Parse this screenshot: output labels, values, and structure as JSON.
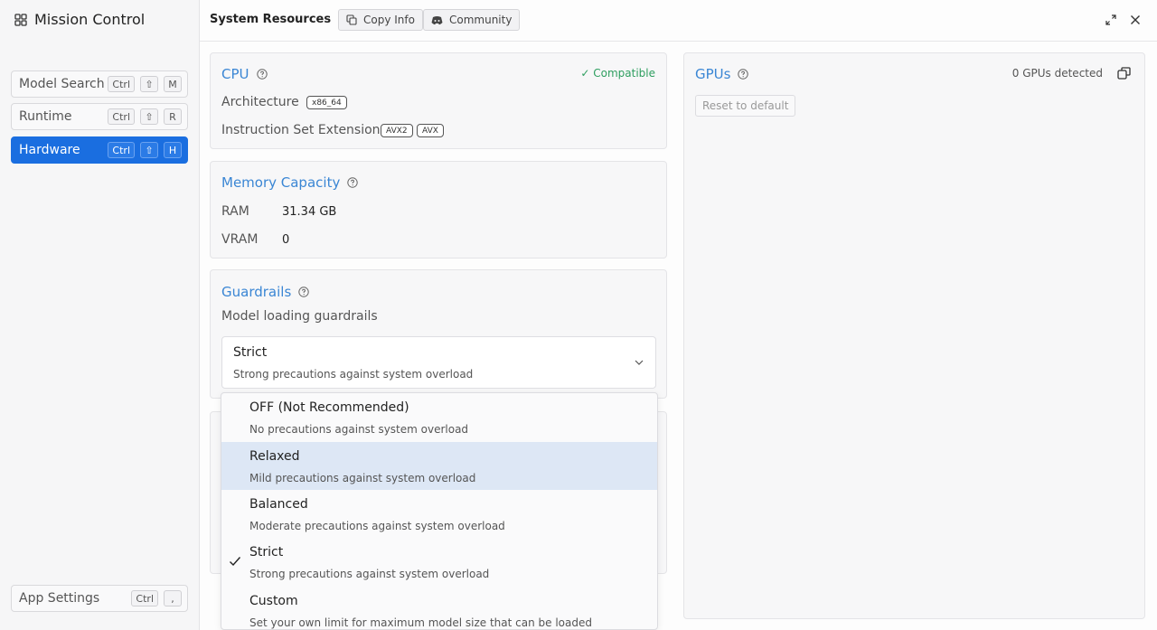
{
  "app": {
    "title": "Mission Control"
  },
  "sidebar": {
    "items": [
      {
        "label": "Model Search",
        "keys": [
          "Ctrl",
          "⇧",
          "M"
        ]
      },
      {
        "label": "Runtime",
        "keys": [
          "Ctrl",
          "⇧",
          "R"
        ]
      },
      {
        "label": "Hardware",
        "keys": [
          "Ctrl",
          "⇧",
          "H"
        ],
        "active": true
      }
    ],
    "settings": {
      "label": "App Settings",
      "keys": [
        "Ctrl",
        ","
      ]
    }
  },
  "topbar": {
    "title": "System Resources",
    "copy_label": "Copy Info",
    "community_label": "Community"
  },
  "cpu": {
    "title": "CPU",
    "status": "✓ Compatible",
    "architecture_label": "Architecture",
    "architecture_value": "x86_64",
    "extensions_label": "Instruction Set Extensions",
    "extensions": [
      "AVX2",
      "AVX"
    ]
  },
  "memory": {
    "title": "Memory Capacity",
    "ram_label": "RAM",
    "ram_value": "31.34 GB",
    "vram_label": "VRAM",
    "vram_value": "0"
  },
  "guardrails": {
    "title": "Guardrails",
    "subtitle": "Model loading guardrails",
    "selected_label": "Strict",
    "selected_desc": "Strong precautions against system overload",
    "options": [
      {
        "label": "OFF (Not Recommended)",
        "desc": "No precautions against system overload"
      },
      {
        "label": "Relaxed",
        "desc": "Mild precautions against system overload",
        "highlighted": true
      },
      {
        "label": "Balanced",
        "desc": "Moderate precautions against system overload"
      },
      {
        "label": "Strict",
        "desc": "Strong precautions against system overload",
        "checked": true
      },
      {
        "label": "Custom",
        "desc": "Set your own limit for maximum model size that can be loaded"
      }
    ]
  },
  "gpus": {
    "title": "GPUs",
    "detected": "0 GPUs detected",
    "reset_label": "Reset to default"
  },
  "colors": {
    "accent": "#1a6ee0",
    "heading": "#3a86d4",
    "success": "#2e9e5f",
    "highlight": "#dde7f5"
  }
}
